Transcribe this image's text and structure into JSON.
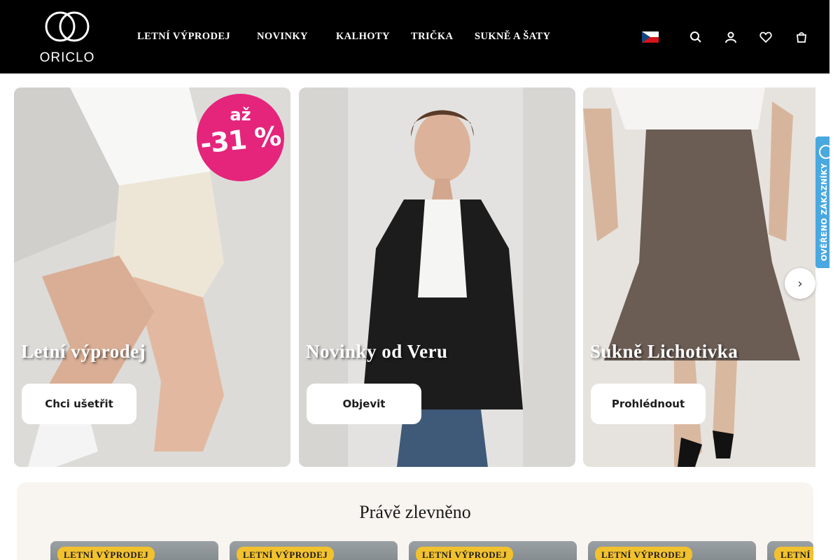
{
  "header": {
    "logo_text": "ORICLO",
    "nav": [
      {
        "label": "LETNÍ VÝPRODEJ",
        "has_dropdown": true
      },
      {
        "label": "NOVINKY",
        "has_dropdown": true
      },
      {
        "label": "KALHOTY",
        "has_dropdown": false
      },
      {
        "label": "TRIČKA",
        "has_dropdown": false
      },
      {
        "label": "SUKNĚ A ŠATY",
        "has_dropdown": false
      }
    ],
    "caret_glyph": "",
    "language_flag": "cz-flag-icon",
    "icons": [
      "search-icon",
      "user-icon",
      "heart-icon",
      "cart-icon"
    ]
  },
  "banners": [
    {
      "title": "Letní výprodej",
      "button": "Chci ušetřit",
      "badge_top": "až",
      "badge_bottom": "-31 %"
    },
    {
      "title": "Novinky od Veru",
      "button": "Objevit"
    },
    {
      "title": "Sukně Lichotivka",
      "button": "Prohlédnout"
    }
  ],
  "carousel_next": "›",
  "verified_tab": {
    "label": "OVĚŘENO ZÁKAZNÍKY"
  },
  "section": {
    "title": "Právě zlevněno",
    "products": [
      {
        "badge": "LETNÍ VÝPRODEJ"
      },
      {
        "badge": "LETNÍ VÝPRODEJ"
      },
      {
        "badge": "LETNÍ VÝPRODEJ"
      },
      {
        "badge": "LETNÍ VÝPRODEJ"
      },
      {
        "badge": "LETNÍ VÝPRODEJ"
      }
    ]
  },
  "colors": {
    "header_bg": "#000000",
    "sale_badge": "#e5247b",
    "product_badge": "#f2c12e",
    "verified_tab": "#4aa8e0",
    "section_bg": "#f8f4ef"
  }
}
